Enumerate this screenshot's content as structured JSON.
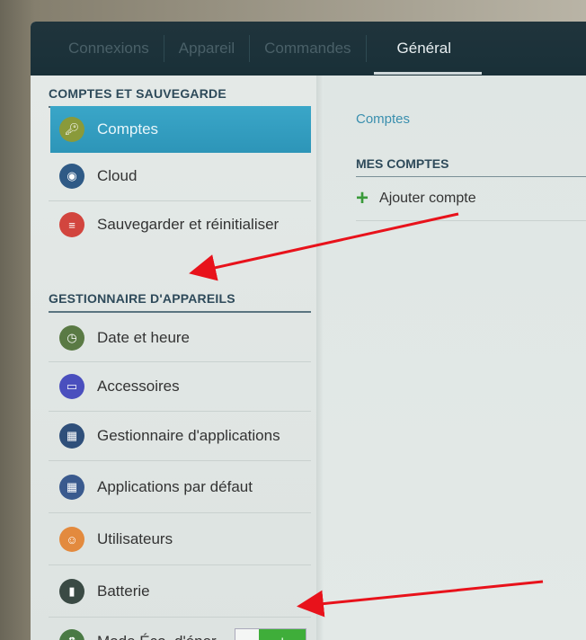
{
  "tabs": [
    {
      "label": "Connexions"
    },
    {
      "label": "Appareil"
    },
    {
      "label": "Commandes"
    },
    {
      "label": "Général"
    }
  ],
  "left": {
    "section1": "COMPTES ET SAUVEGARDE",
    "section2": "GESTIONNAIRE D'APPAREILS",
    "items": [
      {
        "label": "Comptes",
        "icon": "key-icon",
        "color": "#8a9a3a"
      },
      {
        "label": "Cloud",
        "icon": "cloud-eye-icon",
        "color": "#2f5a86"
      },
      {
        "label": "Sauvegarder et réinitialiser",
        "icon": "backup-icon",
        "color": "#d2453e"
      },
      {
        "label": "Date et heure",
        "icon": "calendar-clock-icon",
        "color": "#5a7a44"
      },
      {
        "label": "Accessoires",
        "icon": "accessory-icon",
        "color": "#4a4fbe"
      },
      {
        "label": "Gestionnaire d'applications",
        "icon": "app-grid-icon",
        "color": "#2f4f7a"
      },
      {
        "label": "Applications par défaut",
        "icon": "default-apps-icon",
        "color": "#3a5a8e"
      },
      {
        "label": "Utilisateurs",
        "icon": "users-icon",
        "color": "#e38a3e"
      },
      {
        "label": "Batterie",
        "icon": "battery-icon",
        "color": "#3a4a44"
      },
      {
        "label": "Mode Éco. d'éner..",
        "icon": "power-saving-icon",
        "color": "#4a7a44"
      }
    ]
  },
  "right": {
    "title": "Comptes",
    "section": "MES COMPTES",
    "add_label": "Ajouter compte"
  },
  "toggle": {
    "state": "on",
    "glyph": "I"
  },
  "annotation_color": "#e8121b"
}
